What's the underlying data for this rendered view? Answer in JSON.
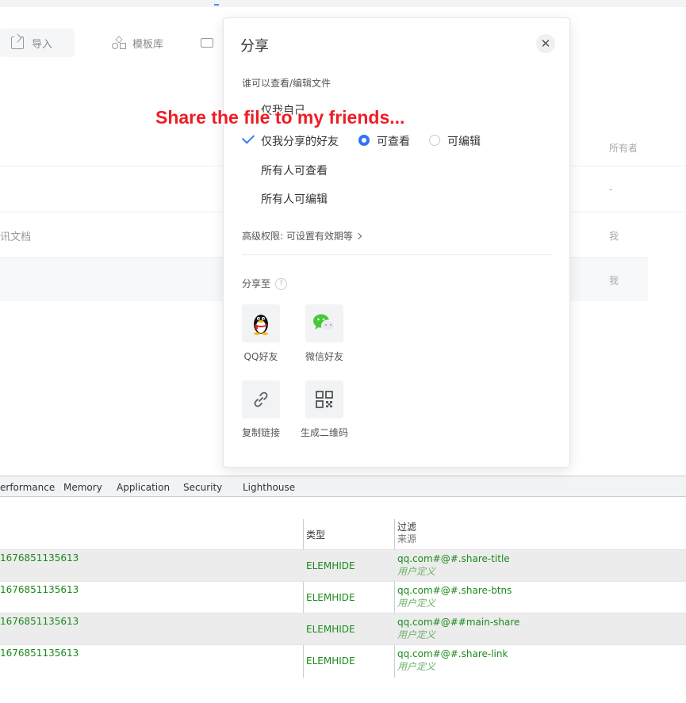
{
  "background_page": {
    "toolbar": {
      "import_label": "导入",
      "template_label": "模板库"
    },
    "list_header": {
      "owner_label": "所有者"
    },
    "rows": [
      {
        "name": "",
        "owner": "-"
      },
      {
        "name": "讯文档",
        "owner": "我"
      },
      {
        "name": "",
        "owner": "我"
      }
    ]
  },
  "share_dialog": {
    "title": "分享",
    "close_glyph": "✕",
    "permission_label": "谁可以查看/编辑文件",
    "options": {
      "only_me": "仅我自己",
      "friends": "仅我分享的好友",
      "everyone_view": "所有人可查看",
      "everyone_edit": "所有人可编辑"
    },
    "friend_access": {
      "view": "可查看",
      "edit": "可编辑",
      "selected": "view"
    },
    "advanced": "高级权限: 可设置有效期等",
    "share_to_label": "分享至",
    "share_targets": [
      {
        "label": "QQ好友",
        "icon": "qq-penguin-icon"
      },
      {
        "label": "微信好友",
        "icon": "wechat-icon"
      },
      {
        "label": "复制链接",
        "icon": "link-icon"
      },
      {
        "label": "生成二维码",
        "icon": "qrcode-icon"
      }
    ]
  },
  "annotation": {
    "text": "Share the file to my friends..."
  },
  "devtools": {
    "tabs": [
      "erformance",
      "Memory",
      "Application",
      "Security",
      "Lighthouse"
    ],
    "columns": {
      "type": "类型",
      "filter": "过滤",
      "source": "来源"
    },
    "rows": [
      {
        "id": "1676851135613",
        "type": "ELEMHIDE",
        "selector": "qq.com#@#.share-title",
        "source": "用户定义"
      },
      {
        "id": "1676851135613",
        "type": "ELEMHIDE",
        "selector": "qq.com#@#.share-btns",
        "source": "用户定义"
      },
      {
        "id": "1676851135613",
        "type": "ELEMHIDE",
        "selector": "qq.com#@##main-share",
        "source": "用户定义"
      },
      {
        "id": "1676851135613",
        "type": "ELEMHIDE",
        "selector": "qq.com#@#.share-link",
        "source": "用户定义"
      }
    ]
  },
  "colors": {
    "accent": "#2f72f4",
    "annotation": "#ee1c24",
    "devtools_green": "#1b8a1b"
  }
}
